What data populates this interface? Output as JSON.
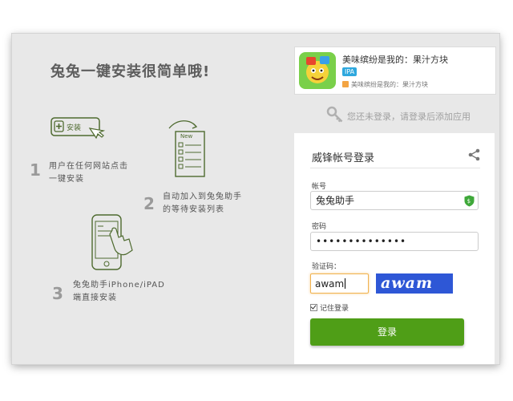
{
  "headline": "兔兔一键安装很简单哦!",
  "illustrations": {
    "install_button_text": "安装",
    "list_header_text": "New"
  },
  "steps": [
    {
      "number": "1",
      "text_line1": "用户在任何网站点击",
      "text_line2": "一键安装"
    },
    {
      "number": "2",
      "text_line1": "自动加入到兔兔助手",
      "text_line2": "的等待安装列表"
    },
    {
      "number": "3",
      "text_line1": "兔兔助手iPhone/iPAD",
      "text_line2": "端直接安装"
    }
  ],
  "app": {
    "name": "美味缤纷是我的：果汁方块",
    "badge": "IPA",
    "subtitle": "美味缤纷是我的：果汁方块"
  },
  "notice": "您还未登录，请登录后添加应用",
  "login": {
    "title": "威锋帐号登录",
    "account_label": "帐号",
    "account_value": "兔兔助手",
    "password_label": "密码",
    "password_value": "••••••••••••••",
    "captcha_label": "验证码：",
    "captcha_value": "awam",
    "captcha_image_text": "awam",
    "remember_label": "记住登录",
    "submit_label": "登录"
  },
  "colors": {
    "accent_green": "#4f9e17",
    "badge_blue": "#2fa8de",
    "captcha_blue": "#2e57d6"
  }
}
